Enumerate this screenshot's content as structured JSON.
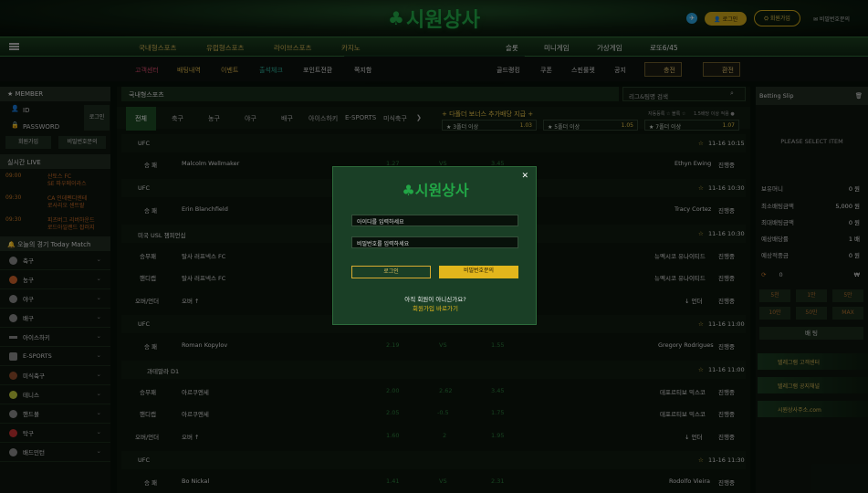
{
  "header": {
    "logo": "시원상사",
    "telegram": "✈",
    "login": "로그인",
    "join": "회원가입",
    "pw_inquiry": "비밀번호문의"
  },
  "nav": {
    "items": [
      "국내형스포츠",
      "유럽형스포츠",
      "라이브스포츠",
      "카지노",
      "슬롯",
      "미니게임",
      "가상게임",
      "로또6/45"
    ]
  },
  "subnav": {
    "items": [
      "고객센터",
      "배팅내역",
      "이벤트",
      "출석체크",
      "포인트전환",
      "쪽지함",
      "골드랭킹",
      "쿠폰",
      "스핀룰렛",
      "공지"
    ],
    "deposit": "충전",
    "withdraw": "환전"
  },
  "sidebar": {
    "member": "MEMBER",
    "id": "ID",
    "password": "PASSWORD",
    "login": "로그인",
    "join": "회원가입",
    "pw": "비밀번호문의",
    "live": "실시간 LIVE",
    "live_items": [
      {
        "time": "09:00",
        "a": "산토스 FC",
        "b": "SE 파우메이라스"
      },
      {
        "time": "09:30",
        "a": "CA 인데펜디엔테",
        "b": "로사리오 센트랄"
      },
      {
        "time": "09:30",
        "a": "피츠버그 리버하운드",
        "b": "로드아일랜드 잡러지"
      }
    ],
    "today": "오늘의 경기 Today Match",
    "sports": [
      "축구",
      "농구",
      "야구",
      "배구",
      "아이스하키",
      "E-SPORTS",
      "미식축구",
      "테니스",
      "핸드볼",
      "탁구",
      "배드민턴"
    ]
  },
  "main": {
    "breadcrumb": "국내형스포츠",
    "search_placeholder": "리그&팀명 검색",
    "tabs": [
      "전체",
      "축구",
      "농구",
      "야구",
      "배구",
      "아이스하키",
      "E-SPORTS",
      "미식축구"
    ],
    "bonus_title": "+ 다폴더 보너스 추가배당 지급 +",
    "bonus_notes": [
      "자동등록 ☆ 블록 ☆",
      "1.5배당 이상 적용 ●"
    ],
    "bonus": [
      {
        "label": "★ 3폴더 이상",
        "val": "1.03"
      },
      {
        "label": "★ 5폴더 이상",
        "val": "1.05"
      },
      {
        "label": "★ 7폴더 이상",
        "val": "1.07"
      }
    ],
    "leagues": [
      {
        "name": "UFC",
        "time": "11-16 10:15",
        "rows": [
          {
            "type": "승 패",
            "home": "Malcolm Wellmaker",
            "o1": "1.27",
            "vs": "VS",
            "o2": "3.45",
            "away": "Ethyn Ewing",
            "state": "진행중"
          }
        ]
      },
      {
        "name": "UFC",
        "time": "11-16 10:30",
        "rows": [
          {
            "type": "승 패",
            "home": "Erin Blanchfield",
            "o1": "",
            "vs": "",
            "o2": "",
            "away": "Tracy Cortez",
            "state": "진행중"
          }
        ]
      },
      {
        "name": "미국 USL 챔피언십",
        "time": "11-16 10:30",
        "rows": [
          {
            "type": "승무패",
            "home": "탈사 러프넥스 FC",
            "o1": "",
            "vs": "",
            "o2": "",
            "away": "뉴멕시코 유나이티드",
            "state": "진행중"
          },
          {
            "type": "핸디캡",
            "home": "탈사 러프넥스 FC",
            "o1": "",
            "vs": "",
            "o2": "",
            "away": "뉴멕시코 유나이티드",
            "state": "진행중"
          },
          {
            "type": "오버/언더",
            "home": "오버 ↑",
            "o1": "",
            "vs": "",
            "o2": "",
            "away": "↓ 언더",
            "state": "진행중"
          }
        ]
      },
      {
        "name": "UFC",
        "time": "11-16 11:00",
        "rows": [
          {
            "type": "승 패",
            "home": "Roman Kopylov",
            "o1": "2.19",
            "vs": "VS",
            "o2": "1.55",
            "away": "Gregory Rodrigues",
            "state": "진행중"
          }
        ]
      },
      {
        "name": "과테말라 D1",
        "time": "11-16 11:00",
        "rows": [
          {
            "type": "승무패",
            "home": "아르쿠엔세",
            "o1": "2.00",
            "vs": "2.62",
            "o2": "3.45",
            "away": "데포르티보 믹스코",
            "state": "진행중"
          },
          {
            "type": "핸디캡",
            "home": "아르쿠엔세",
            "o1": "2.05",
            "vs": "-0.5",
            "o2": "1.75",
            "away": "데포르티보 믹스코",
            "state": "진행중"
          },
          {
            "type": "오버/언더",
            "home": "오버 ↑",
            "o1": "1.60",
            "vs": "2",
            "o2": "1.95",
            "away": "↓ 언더",
            "state": "진행중"
          }
        ]
      },
      {
        "name": "UFC",
        "time": "11-16 11:30",
        "rows": [
          {
            "type": "승 패",
            "home": "Bo Nickal",
            "o1": "1.41",
            "vs": "VS",
            "o2": "2.31",
            "away": "Rodolfo Vieira",
            "state": "진행중"
          }
        ]
      }
    ]
  },
  "slip": {
    "title": "Betting Slip",
    "empty": "PLEASE SELECT ITEM",
    "rows": [
      {
        "k": "보유머니",
        "v": "0 원"
      },
      {
        "k": "최소배팅금액",
        "v": "5,000 원"
      },
      {
        "k": "최대배팅금액",
        "v": "0 원"
      },
      {
        "k": "예상배당률",
        "v": "1 배"
      },
      {
        "k": "예상적중금",
        "v": "0 원"
      }
    ],
    "amount": "0",
    "unit": "₩",
    "btns": [
      "5천",
      "1만",
      "5만",
      "10만",
      "50만",
      "MAX"
    ],
    "bet": "배 팅",
    "banners": [
      "텔레그램 고객센터",
      "텔레그램 공지채널",
      "시원상사주소.com"
    ]
  },
  "modal": {
    "logo": "시원상사",
    "close": "✕",
    "id_placeholder": "아이디를 입력하세요",
    "pw_placeholder": "비밀번호를 입력하세요",
    "login": "로그인",
    "pw_inquiry": "비밀번호문의",
    "question": "아직 회원이 아니신가요?",
    "join_link": "회원가입 바로가기"
  }
}
